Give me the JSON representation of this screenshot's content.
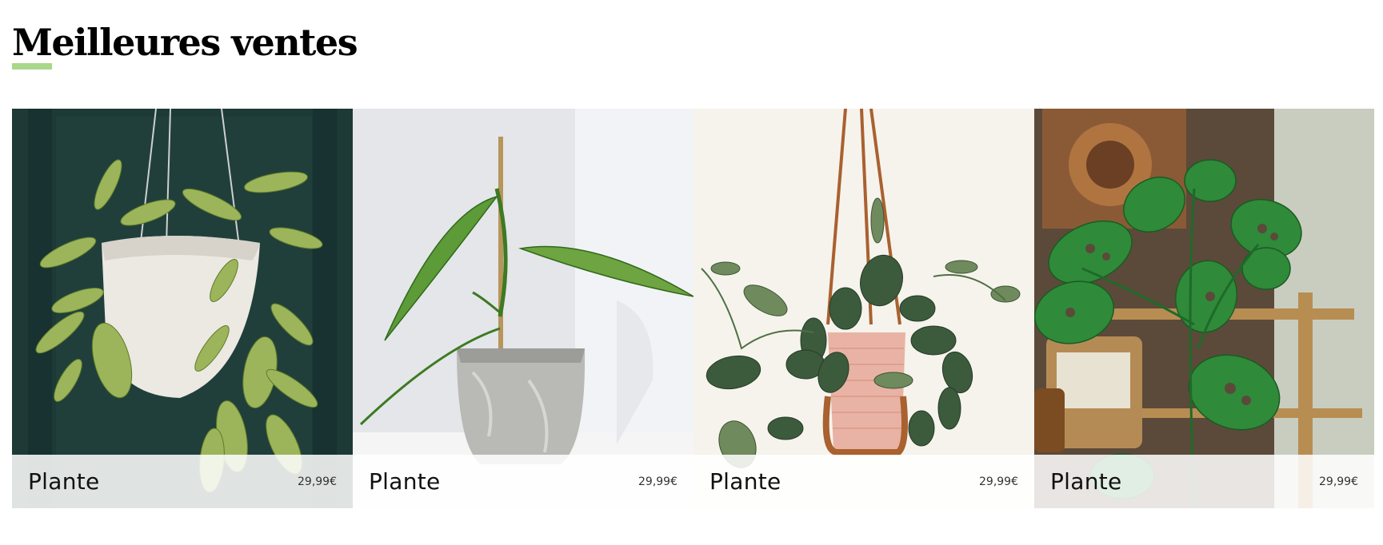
{
  "section": {
    "title": "Meilleures ventes",
    "accent_color": "#a8d88a"
  },
  "products": [
    {
      "name": "Plante",
      "price": "29,99€",
      "image": "hanging-plant-white-pot-image"
    },
    {
      "name": "Plante",
      "price": "29,99€",
      "image": "plant-grey-concrete-pot-image"
    },
    {
      "name": "Plante",
      "price": "29,99€",
      "image": "hanging-plant-pink-pot-image"
    },
    {
      "name": "Plante",
      "price": "29,99€",
      "image": "monstera-shelf-image"
    }
  ]
}
